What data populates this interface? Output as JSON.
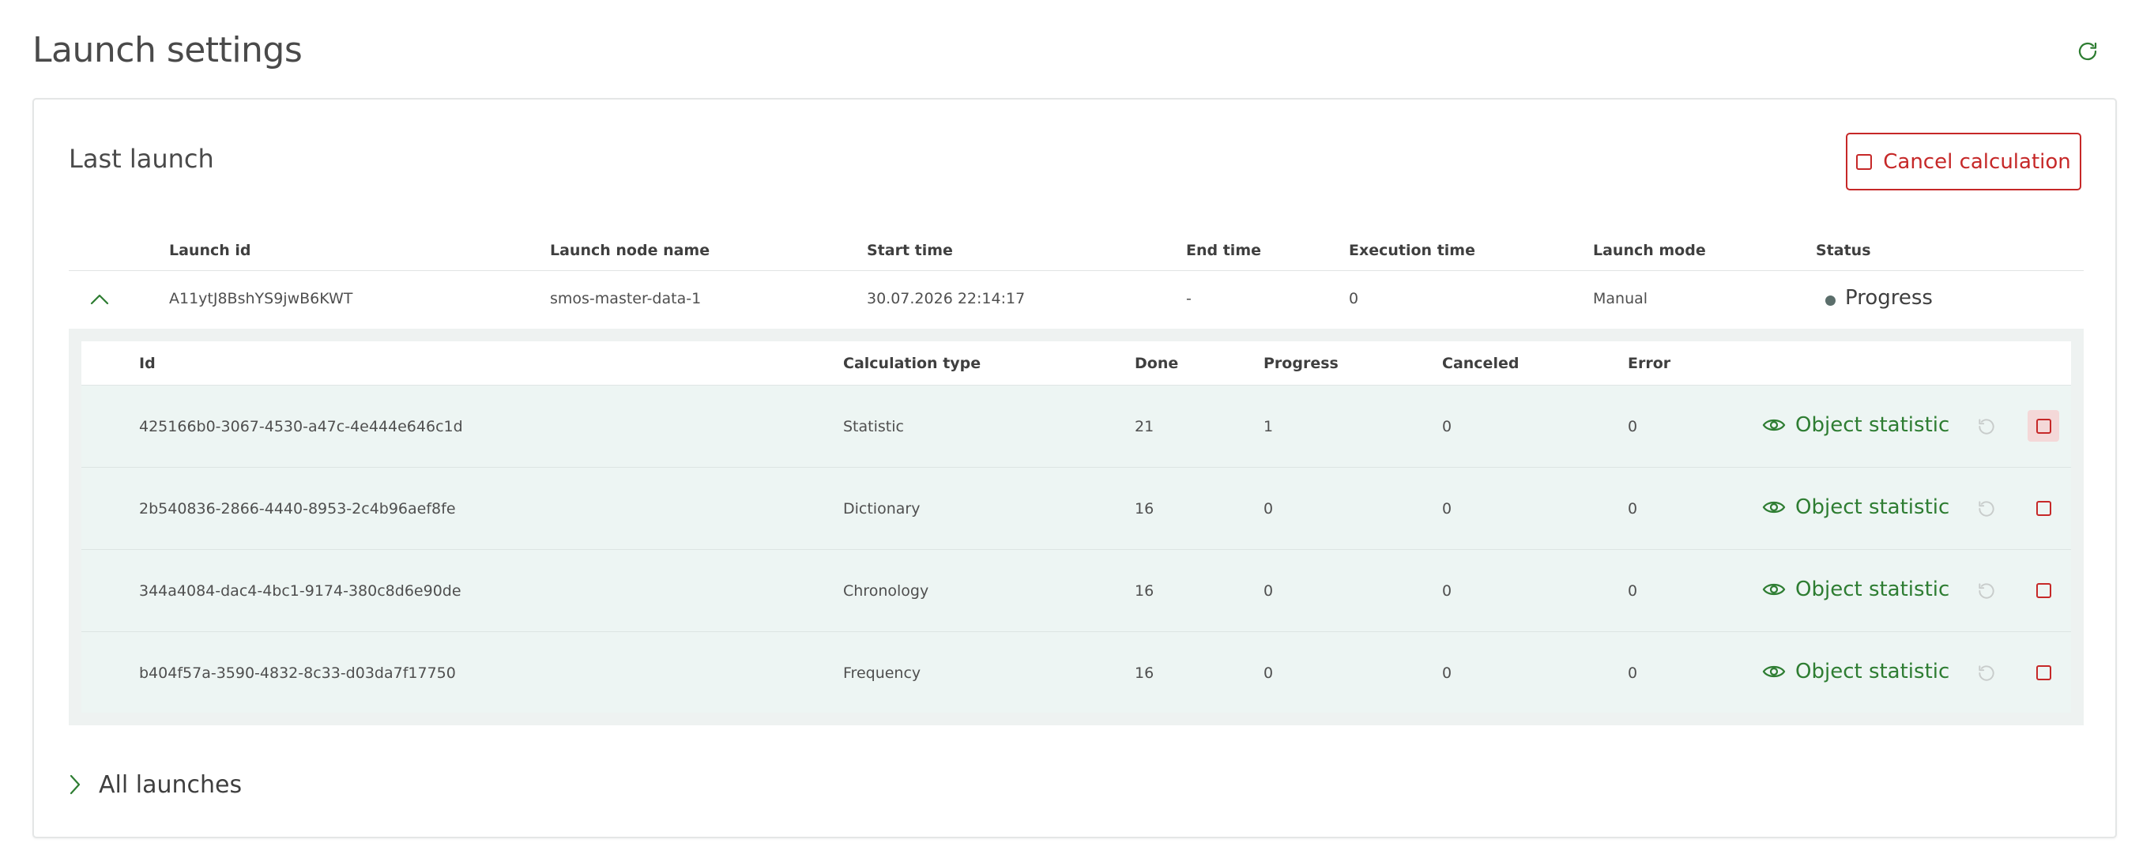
{
  "page": {
    "title": "Launch settings"
  },
  "last_launch": {
    "title": "Last launch",
    "cancel_label": "Cancel calculation",
    "columns": [
      "Launch id",
      "Launch node name",
      "Start time",
      "End time",
      "Execution time",
      "Launch mode",
      "Status"
    ],
    "row": {
      "launch_id": "A11ytJ8BshYS9jwB6KWT",
      "node_name": "smos-master-data-1",
      "start_time": "30.07.2026 22:14:17",
      "end_time": "-",
      "execution_time": "0",
      "launch_mode": "Manual",
      "status": "Progress"
    },
    "details": {
      "columns": [
        "Id",
        "Calculation type",
        "Done",
        "Progress",
        "Canceled",
        "Error"
      ],
      "action_label": "Object statistic",
      "rows": [
        {
          "id": "425166b0-3067-4530-a47c-4e444e646c1d",
          "type": "Statistic",
          "done": "21",
          "progress": "1",
          "canceled": "0",
          "error": "0"
        },
        {
          "id": "2b540836-2866-4440-8953-2c4b96aef8fe",
          "type": "Dictionary",
          "done": "16",
          "progress": "0",
          "canceled": "0",
          "error": "0"
        },
        {
          "id": "344a4084-dac4-4bc1-9174-380c8d6e90de",
          "type": "Chronology",
          "done": "16",
          "progress": "0",
          "canceled": "0",
          "error": "0"
        },
        {
          "id": "b404f57a-3590-4832-8c33-d03da7f17750",
          "type": "Frequency",
          "done": "16",
          "progress": "0",
          "canceled": "0",
          "error": "0"
        }
      ]
    }
  },
  "all_launches": {
    "label": "All launches"
  },
  "colors": {
    "accent": "#2e7d32",
    "danger": "#c62828",
    "row_bg": "#edf5f3"
  },
  "icons": [
    "refresh-icon",
    "chevron-up-icon",
    "eye-icon",
    "restart-icon",
    "stop-icon",
    "chevron-right-icon"
  ]
}
